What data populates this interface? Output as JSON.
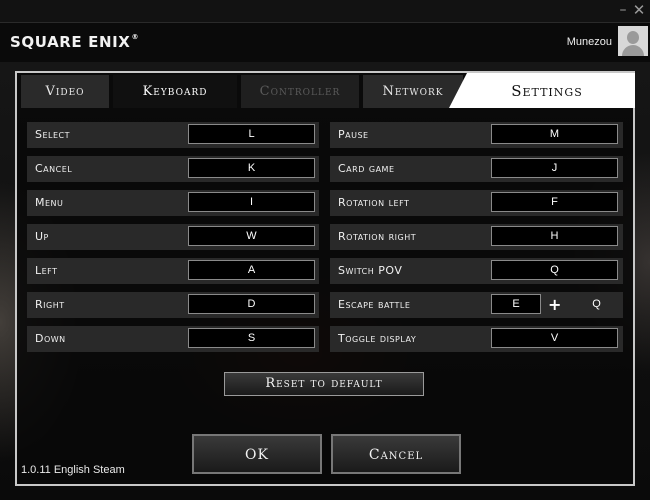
{
  "window": {
    "minimize_glyph": "–",
    "close_glyph": "✕"
  },
  "header": {
    "brand": "SQUARE ENIX",
    "registered": "®",
    "username": "Munezou"
  },
  "tabs": {
    "video": "Video",
    "keyboard": "Keyboard",
    "controller": "Controller",
    "network": "Network",
    "settings": "Settings"
  },
  "bindings": {
    "left": [
      {
        "action": "Select",
        "key": "L"
      },
      {
        "action": "Cancel",
        "key": "K"
      },
      {
        "action": "Menu",
        "key": "I"
      },
      {
        "action": "Up",
        "key": "W"
      },
      {
        "action": "Left",
        "key": "A"
      },
      {
        "action": "Right",
        "key": "D"
      },
      {
        "action": "Down",
        "key": "S"
      }
    ],
    "right": [
      {
        "action": "Pause",
        "key": "M"
      },
      {
        "action": "Card game",
        "key": "J"
      },
      {
        "action": "Rotation left",
        "key": "F"
      },
      {
        "action": "Rotation right",
        "key": "H"
      },
      {
        "action": "Switch POV",
        "key": "Q"
      },
      {
        "action": "Escape battle",
        "key": "E",
        "plus": "+",
        "key2": "Q"
      },
      {
        "action": "Toggle display",
        "key": "V"
      }
    ]
  },
  "buttons": {
    "reset": "Reset to default",
    "ok": "OK",
    "cancel": "Cancel"
  },
  "version": "1.0.11 English Steam",
  "colors": {
    "tab_active": "#ffffff",
    "panel_border": "#c8c8c8",
    "row_bg": "#2d2d2d",
    "controller_disabled": "#5a5a5a"
  }
}
